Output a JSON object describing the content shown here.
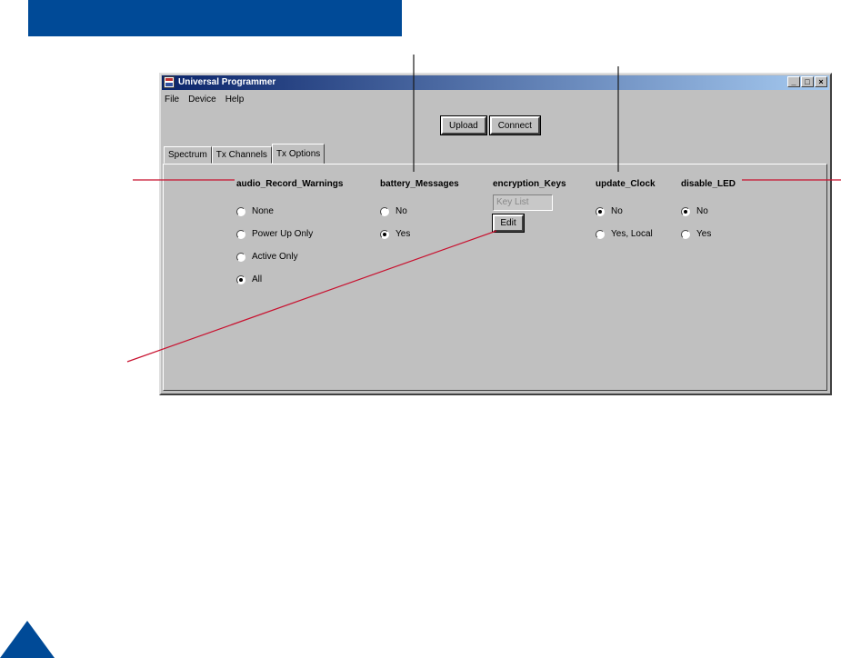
{
  "window": {
    "title": "Universal Programmer",
    "controls": [
      "_",
      "□",
      "×"
    ]
  },
  "menu": [
    "File",
    "Device",
    "Help"
  ],
  "toolbar": {
    "upload_label": "Upload",
    "connect_label": "Connect"
  },
  "tabs": [
    {
      "label": "Spectrum",
      "active": false
    },
    {
      "label": "Tx Channels",
      "active": false
    },
    {
      "label": "Tx Options",
      "active": true
    }
  ],
  "groups": {
    "audio": {
      "title": "audio_Record_Warnings",
      "options": [
        {
          "label": "None",
          "checked": false
        },
        {
          "label": "Power Up Only",
          "checked": false
        },
        {
          "label": "Active Only",
          "checked": false
        },
        {
          "label": "All",
          "checked": true
        }
      ]
    },
    "battery": {
      "title": "battery_Messages",
      "options": [
        {
          "label": "No",
          "checked": false
        },
        {
          "label": "Yes",
          "checked": true
        }
      ]
    },
    "encryption": {
      "title": "encryption_Keys",
      "field_value": "Key List",
      "edit_label": "Edit"
    },
    "clock": {
      "title": "update_Clock",
      "options": [
        {
          "label": "No",
          "checked": true
        },
        {
          "label": "Yes, Local",
          "checked": false
        }
      ]
    },
    "led": {
      "title": "disable_LED",
      "options": [
        {
          "label": "No",
          "checked": true
        },
        {
          "label": "Yes",
          "checked": false
        }
      ]
    }
  },
  "colors": {
    "brand_blue": "#004a97",
    "callout_red": "#c8102e",
    "window_gray": "#c0c0c0"
  }
}
